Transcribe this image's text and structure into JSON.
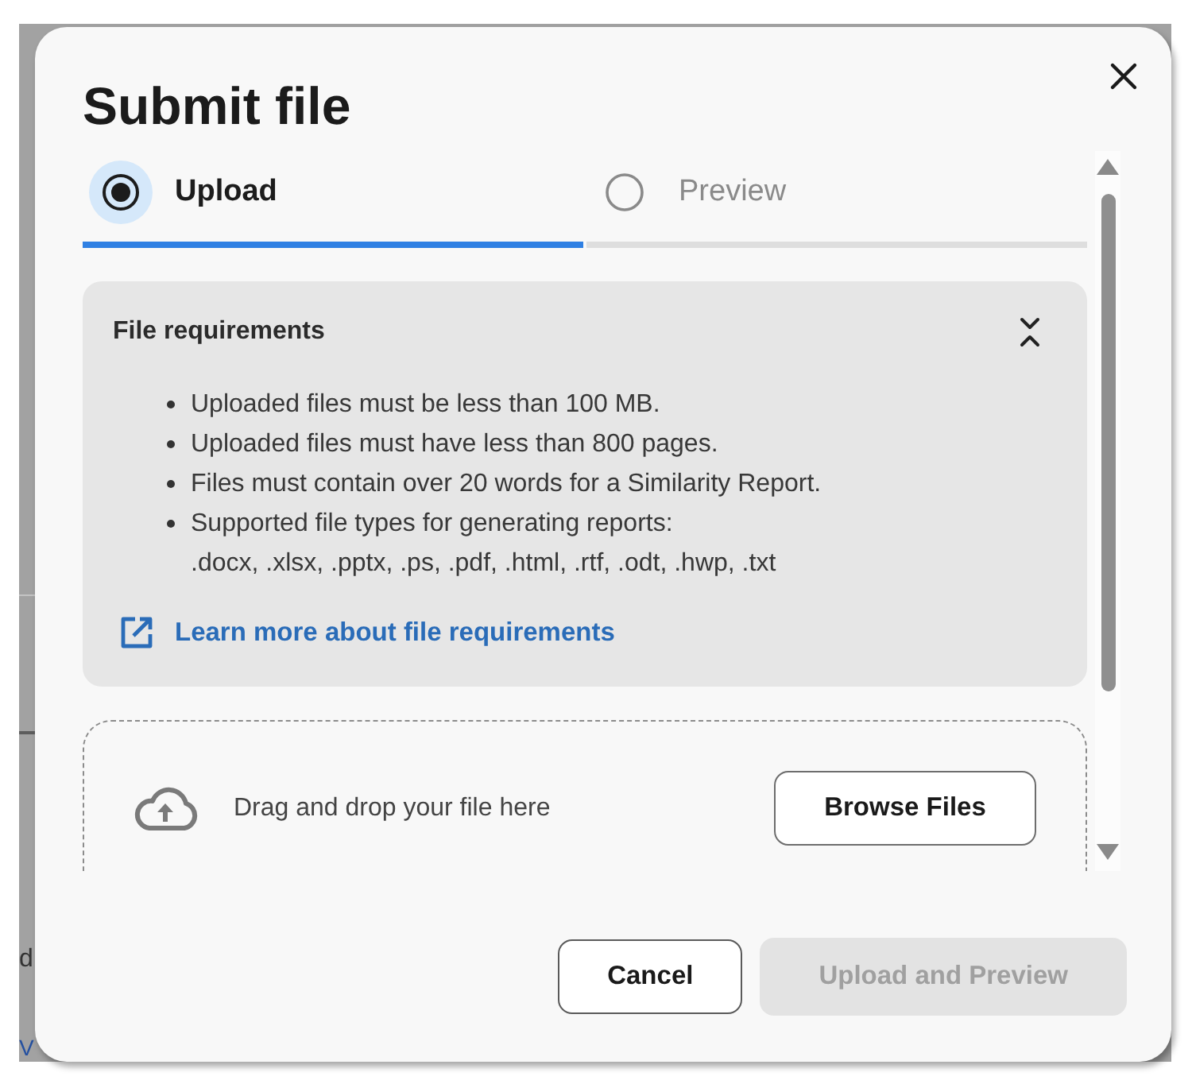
{
  "background_page": {
    "fragments": [
      {
        "text": "d",
        "kind": "text"
      },
      {
        "text": "V",
        "kind": "link"
      }
    ]
  },
  "dialog": {
    "title": "Submit file"
  },
  "steps": [
    {
      "label": "Upload",
      "selected": true
    },
    {
      "label": "Preview",
      "selected": false
    }
  ],
  "requirements": {
    "title": "File requirements",
    "expanded": true,
    "items": [
      "Uploaded files must be less than 100 MB.",
      "Uploaded files must have less than 800 pages.",
      "Files must contain over 20 words for a Similarity Report.",
      "Supported file types for generating reports:\n.docx, .xlsx, .pptx, .ps, .pdf, .html, .rtf, .odt, .hwp, .txt"
    ],
    "link": "Learn more about file requirements"
  },
  "dropzone": {
    "text": "Drag and drop your file here",
    "button": "Browse Files"
  },
  "buttons": [
    {
      "label": "Cancel",
      "kind": "secondary",
      "disabled": false
    },
    {
      "label": "Upload and Preview",
      "kind": "primary",
      "disabled": true
    }
  ]
}
